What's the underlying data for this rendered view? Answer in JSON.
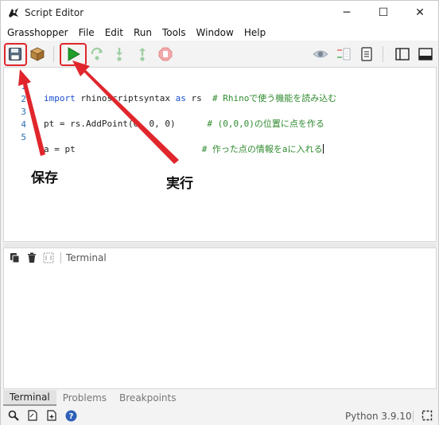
{
  "window": {
    "title": "Script Editor",
    "controls": {
      "minimize": "─",
      "maximize": "☐",
      "close": "✕"
    }
  },
  "menu": {
    "items": [
      "Grasshopper",
      "File",
      "Edit",
      "Run",
      "Tools",
      "Window",
      "Help"
    ]
  },
  "toolbar": {
    "buttons": [
      "save-icon",
      "package-icon",
      "run-icon",
      "step-over-icon",
      "step-into-icon",
      "step-out-icon",
      "stop-icon",
      "eye-icon",
      "compare-icon",
      "notes-icon",
      "layout-left-icon",
      "layout-bottom-icon"
    ]
  },
  "editor": {
    "lines": [
      {
        "num": "1",
        "tokens": [
          {
            "t": "import ",
            "c": "kw"
          },
          {
            "t": "rhinoscriptsyntax ",
            "c": ""
          },
          {
            "t": "as ",
            "c": "kw"
          },
          {
            "t": "rs  ",
            "c": ""
          },
          {
            "t": "# Rhinoで使う機能を読み込む",
            "c": "cmt"
          }
        ]
      },
      {
        "num": "2",
        "tokens": []
      },
      {
        "num": "3",
        "tokens": [
          {
            "t": "pt = rs.AddPoint(",
            "c": ""
          },
          {
            "t": "0",
            "c": "num"
          },
          {
            "t": ", ",
            "c": ""
          },
          {
            "t": "0",
            "c": "num"
          },
          {
            "t": ", ",
            "c": ""
          },
          {
            "t": "0",
            "c": "num"
          },
          {
            "t": ")      ",
            "c": ""
          },
          {
            "t": "# (0,0,0)の位置に点を作る",
            "c": "cmt"
          }
        ]
      },
      {
        "num": "4",
        "tokens": []
      },
      {
        "num": "5",
        "tokens": [
          {
            "t": "a = pt                        ",
            "c": ""
          },
          {
            "t": "# 作った点の情報をaに入れる",
            "c": "cmt"
          }
        ]
      }
    ]
  },
  "annotations": {
    "save_label": "保存",
    "run_label": "実行",
    "color": "#e0262c"
  },
  "terminal": {
    "label": "Terminal"
  },
  "bottom_tabs": [
    "Terminal",
    "Problems",
    "Breakpoints"
  ],
  "statusbar": {
    "python_version": "Python 3.9.10"
  },
  "colors": {
    "run_green": "#1f9e2a",
    "keyword_blue": "#1a4fd0",
    "comment_green": "#2f8a2f",
    "line_number_blue": "#2b6fb0"
  }
}
